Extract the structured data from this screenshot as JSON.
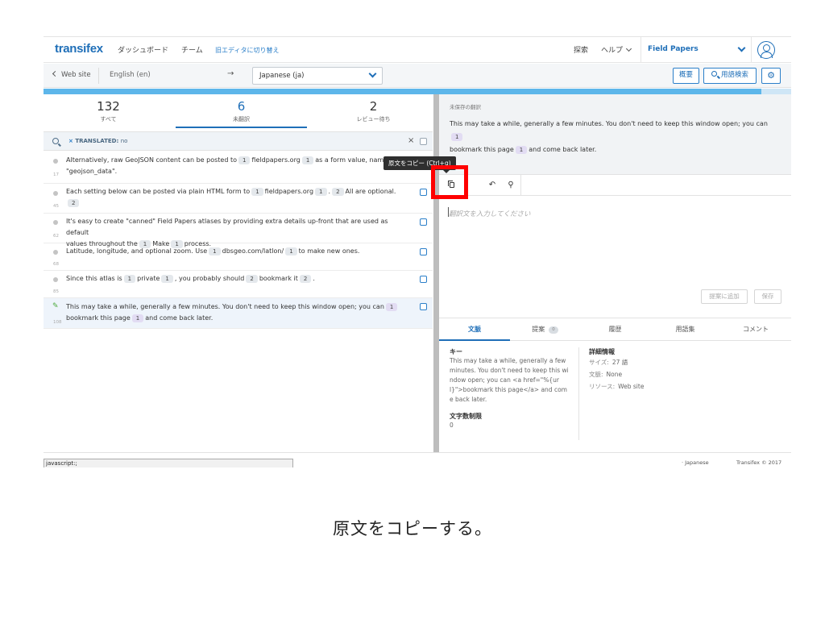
{
  "header": {
    "logo": "transifex",
    "dashboard": "ダッシュボード",
    "team": "チーム",
    "old_editor": "旧エディタに切り替え",
    "search": "探索",
    "help": "ヘルプ",
    "project": "Field Papers"
  },
  "toolbar": {
    "back": "Web site",
    "source_lang": "English (en)",
    "arrow": "→",
    "target_lang": "Japanese (ja)",
    "overview": "概要",
    "glossary_search": "用語検索",
    "settings_icon": "gear-icon"
  },
  "progress": {
    "percent": 96
  },
  "stats": [
    {
      "count": "132",
      "label": "すべて"
    },
    {
      "count": "6",
      "label": "未翻訳"
    },
    {
      "count": "2",
      "label": "レビュー待ち"
    }
  ],
  "filter": {
    "prefix": "×",
    "tag": "TRANSLATED:",
    "value": "no",
    "clear": "×"
  },
  "rows": [
    {
      "index": "17",
      "pre": "Alternatively, raw GeoJSON content can be posted to",
      "p1": "1",
      "mid": "fieldpapers.org",
      "p2": "1",
      "post": "as a form value, nam",
      "line2": "\"geojson_data\"."
    },
    {
      "index": "45",
      "pre": "Each setting below can be posted via plain HTML form to",
      "p1": "1",
      "mid": "fieldpapers.org",
      "p2": "1",
      "mid2": ".",
      "p3": "2",
      "post": "All are optional.",
      "p4": "2"
    },
    {
      "index": "62",
      "pre": "It's easy to create \"canned\" Field Papers atlases by providing extra details up-front that are used as default",
      "line2a": "values throughout the",
      "p1": "1",
      "mid": "Make",
      "p2": "1",
      "post": "process."
    },
    {
      "index": "68",
      "pre": "Latitude, longitude, and optional zoom. Use",
      "p1": "1",
      "mid": "dbsgeo.com/latlon/",
      "p2": "1",
      "post": "to make new ones."
    },
    {
      "index": "85",
      "pre": "Since this atlas is",
      "p1": "1",
      "mid": "private",
      "p2": "1",
      "mid2": ", you probably should",
      "p3": "2",
      "mid3": "bookmark it",
      "p4": "2",
      "post": "."
    },
    {
      "index": "108",
      "pre": "This may take a while, generally a few minutes. You don't need to keep this window open; you can",
      "p1": "1",
      "line2a": "bookmark this page",
      "p2": "1",
      "post": "and come back later."
    }
  ],
  "unsaved": {
    "label": "未保存の翻訳",
    "line1": "This may take a while, generally a few minutes. You don't need to keep this window open; you can",
    "p1": "1",
    "line2": "bookmark this page",
    "p2": "1",
    "line2b": "and come back later."
  },
  "editor": {
    "tooltip": "原文をコピー (Ctrl+g)",
    "placeholder": "翻訳文を入力してください",
    "add_suggestion": "提案に追加",
    "save": "保存"
  },
  "tabs": [
    {
      "label": "文脈"
    },
    {
      "label": "提案",
      "badge": "0"
    },
    {
      "label": "履歴"
    },
    {
      "label": "用語集"
    },
    {
      "label": "コメント"
    }
  ],
  "context": {
    "key_title": "キー",
    "key_text": "This may take a while, generally a few minutes. You don't need to keep this window open; you can <a href=\"%{url}\">bookmark this page</a> and come back later.",
    "limit_title": "文字数制限",
    "limit_value": "0",
    "details_title": "詳細情報",
    "size_label": "サイズ:",
    "size_value": "27 語",
    "context_label": "文脈:",
    "context_value": "None",
    "resource_label": "リソース:",
    "resource_value": "Web site"
  },
  "footer": {
    "status": "javascript:;",
    "lang": "· Japanese",
    "copyright": "Transifex © 2017"
  },
  "caption": "原文をコピーする。",
  "colors": {
    "accent": "#1f6fb8",
    "highlight": "#ff0000",
    "progress": "#5db6ea"
  }
}
